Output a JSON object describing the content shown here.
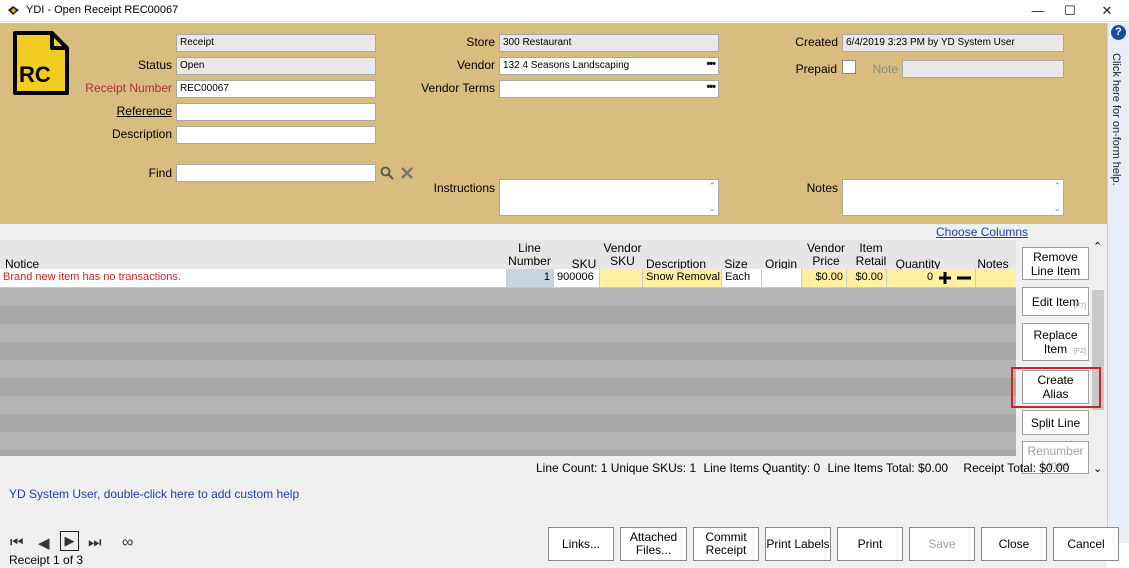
{
  "window": {
    "title": "YDI - Open Receipt REC00067",
    "min": "—",
    "max": "☐",
    "close": "✕"
  },
  "badge": {
    "text": "RC"
  },
  "header": {
    "type_value": "Receipt",
    "status_label": "Status",
    "status_value": "Open",
    "receipt_number_label": "Receipt Number",
    "receipt_number_value": "REC00067",
    "reference_label": "Reference",
    "reference_value": "",
    "description_label": "Description",
    "description_value": "",
    "find_label": "Find",
    "find_value": "",
    "store_label": "Store",
    "store_value": "300 Restaurant",
    "vendor_label": "Vendor",
    "vendor_value": "132 4 Seasons Landscaping",
    "vendor_terms_label": "Vendor Terms",
    "vendor_terms_value": "",
    "instructions_label": "Instructions",
    "created_label": "Created",
    "created_value": "6/4/2019 3:23 PM by YD System User",
    "prepaid_label": "Prepaid",
    "note_label": "Note",
    "note_value": "",
    "notes_label": "Notes",
    "ellipsis": "•••"
  },
  "help": {
    "text": "Click here for on-form help.",
    "icon": "?"
  },
  "grid": {
    "choose_columns": "Choose Columns",
    "columns": {
      "notice": "Notice",
      "line_number": "Line\nNumber",
      "sku": "SKU",
      "vendor_sku": "Vendor\nSKU",
      "description": "Description",
      "size": "Size",
      "origin": "Origin",
      "vendor_price": "Vendor\nPrice",
      "item_retail": "Item\nRetail",
      "quantity": "Quantity",
      "notes": "Notes"
    },
    "row": {
      "notice": "Brand new item has no transactions.",
      "line_number": "1",
      "sku": "900006",
      "vendor_sku": "",
      "description": "Snow Removal",
      "size": "Each",
      "origin": "",
      "vendor_price": "$0.00",
      "item_retail": "$0.00",
      "quantity": "0",
      "notes": ""
    },
    "summary": {
      "line_count": "Line Count: 1",
      "unique_skus": "Unique SKUs: 1",
      "line_items_quantity": "Line Items Quantity: 0",
      "line_items_total": "Line Items Total: $0.00",
      "receipt_total": "Receipt Total: $0.00"
    }
  },
  "side_buttons": {
    "remove_line_item": "Remove\nLine Item",
    "edit_item": "Edit Item",
    "edit_item_key": "[F7]",
    "replace_item": "Replace\nItem",
    "replace_item_key": "[F2]",
    "create_alias": "Create\nAlias",
    "split_line": "Split Line",
    "renumber_lines": "Renumber\nLines"
  },
  "custom_help": "YD System User, double-click here to add custom help",
  "pager": {
    "text": "Receipt 1 of 3",
    "infinity": "∞"
  },
  "footer_buttons": {
    "links": "Links...",
    "attached_files": "Attached\nFiles...",
    "commit_receipt": "Commit\nReceipt",
    "print_labels": "Print Labels",
    "print": "Print",
    "save": "Save",
    "close": "Close",
    "cancel": "Cancel"
  },
  "colors": {
    "header_bg": "#d8bd7e",
    "accent_red": "#d42020",
    "link": "#1a3fb0",
    "row_highlight": "#fff0a0"
  }
}
